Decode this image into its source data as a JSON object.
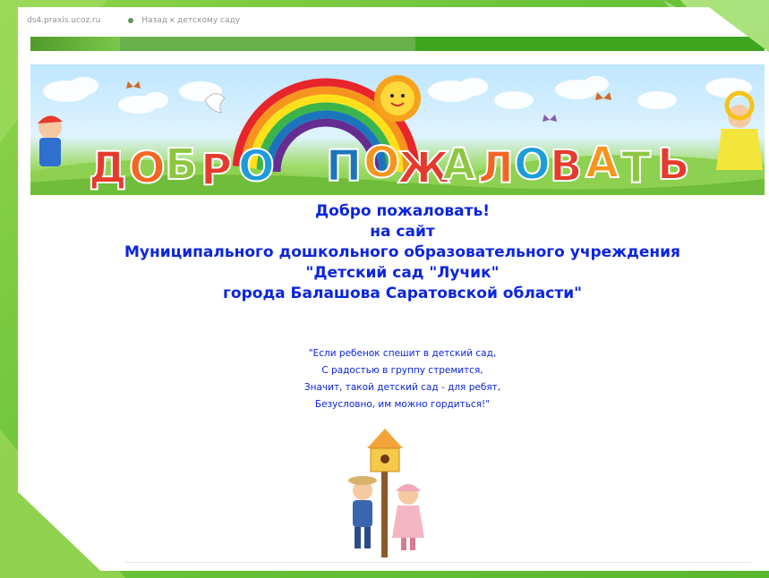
{
  "browser": {
    "address_text": "ds4.praxis.ucoz.ru",
    "tab_text": "Назад к детскому саду"
  },
  "banner": {
    "letters": [
      "Д",
      "О",
      "Б",
      "Р",
      "О",
      "П",
      "О",
      "Ж",
      "А",
      "Л",
      "О",
      "В",
      "А",
      "Т",
      "Ь"
    ]
  },
  "welcome": {
    "line1": "Добро пожаловать!",
    "line2": "на сайт",
    "line3": "Муниципального дошкольного образовательного учреждения",
    "line4": "\"Детский сад \"Лучик\"",
    "line5": "города  Балашова Саратовской области\""
  },
  "poem": {
    "line1": "\"Если ребенок спешит в детский сад,",
    "line2": "С радостью в группу стремится,",
    "line3": "Значит, такой детский сад - для ребят,",
    "line4": "Безусловно, им можно гордиться!\""
  },
  "colors": {
    "background": "#6cc43a",
    "text_blue": "#0b24e0",
    "bar_green": "#3ea51f"
  }
}
